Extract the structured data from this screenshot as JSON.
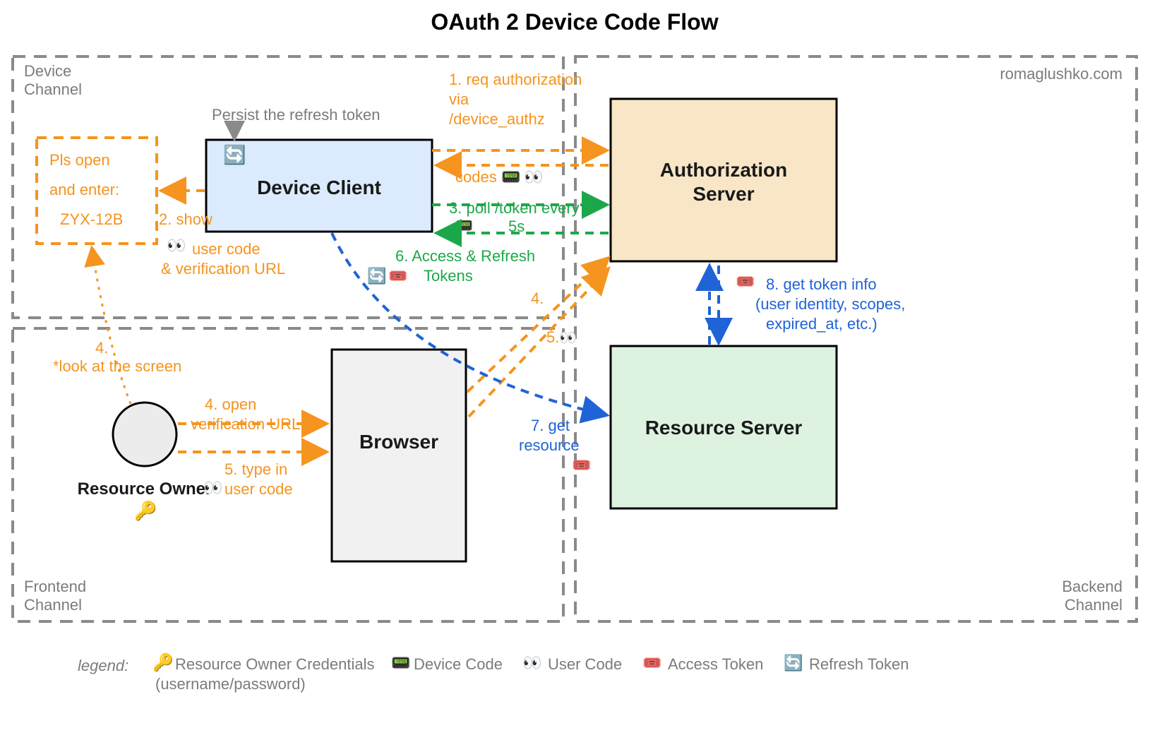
{
  "title": "OAuth 2 Device Code Flow",
  "watermark": "romaglushko.com",
  "channels": {
    "device": "Device\nChannel",
    "frontend": "Frontend\nChannel",
    "backend": "Backend\nChannel"
  },
  "entities": {
    "userCodeBox": "Pls open\nand enter:\nZYX-12B",
    "deviceClient": "Device Client",
    "persistNote": "Persist the refresh token",
    "browser": "Browser",
    "resourceOwner": "Resource Owner",
    "authServer": "Authorization\nServer",
    "resourceServer": "Resource Server"
  },
  "steps": {
    "s1": "1. req authorization\nvia\n/device_authz",
    "codes": "codes",
    "s2": "2. show",
    "s2b": "user code\n& verification URL",
    "s3": "3. poll /token every\n5s",
    "s4look": "4.\n*look at the screen",
    "s4open": "4. open\nverification URL",
    "s4": "4.",
    "s5": "5.",
    "s5type": "5. type in\nuser code",
    "s6": "6. Access & Refresh\nTokens",
    "s7": "7. get\nresource",
    "s8": "8. get token info\n(user identity, scopes,\nexpired_at, etc.)"
  },
  "legend": {
    "title": "legend:",
    "cred": "Resource Owner Credentials\n(username/password)",
    "deviceCode": "Device Code",
    "userCode": "User Code",
    "accessToken": "Access Token",
    "refreshToken": "Refresh Token"
  },
  "icons": {
    "key": "🔑",
    "eyes": "👀",
    "pager": "📟",
    "ticket": "🎟️",
    "refresh": "🔄"
  }
}
